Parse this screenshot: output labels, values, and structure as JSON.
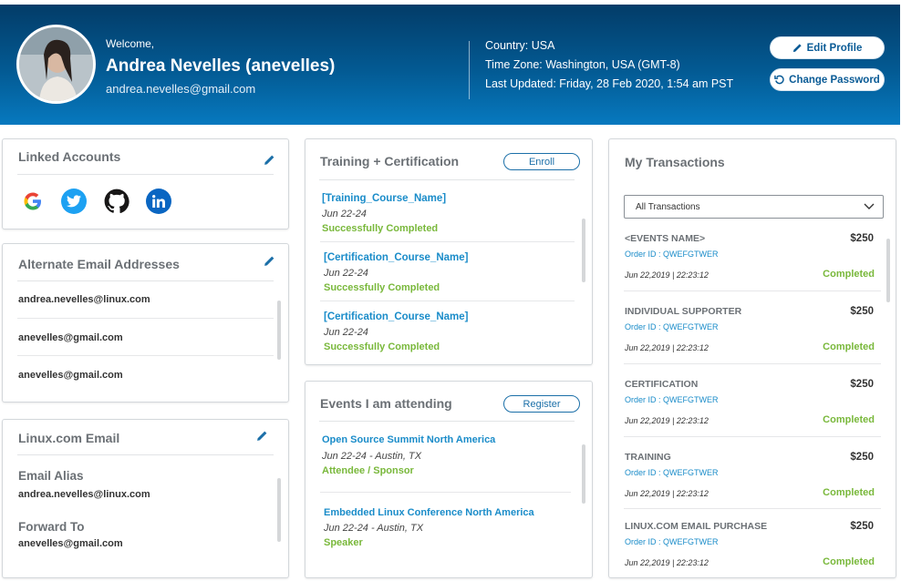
{
  "header": {
    "welcome": "Welcome,",
    "name": "Andrea Nevelles (anevelles)",
    "email": "andrea.nevelles@gmail.com",
    "country": "Country: USA",
    "timezone": "Time Zone: Washington, USA (GMT-8)",
    "last_updated": "Last Updated: Friday, 28 Feb 2020, 1:54 am PST",
    "edit_profile": "Edit Profile",
    "change_password": "Change Password"
  },
  "linked_accounts": {
    "title": "Linked Accounts",
    "accounts": [
      {
        "icon": "google-icon",
        "color": "#4285f4"
      },
      {
        "icon": "twitter-icon",
        "color": "#1da1f2"
      },
      {
        "icon": "github-icon",
        "color": "#181717"
      },
      {
        "icon": "linkedin-icon",
        "color": "#0a66c2"
      }
    ]
  },
  "alternate_emails": {
    "title": "Alternate Email Addresses",
    "emails": [
      "andrea.nevelles@linux.com",
      "anevelles@gmail.com",
      "anevelles@gmail.com"
    ]
  },
  "linux_email": {
    "title": "Linux.com Email",
    "alias_label": "Email Alias",
    "alias_value": "andrea.nevelles@linux.com",
    "forward_label": "Forward To",
    "forward_value": "anevelles@gmail.com"
  },
  "training": {
    "title": "Training + Certification",
    "button": "Enroll",
    "items": [
      {
        "name": "[Training_Course_Name]",
        "date": "Jun 22-24",
        "status": "Successfully Completed"
      },
      {
        "name": "[Certification_Course_Name]",
        "date": "Jun 22-24",
        "status": "Successfully Completed"
      },
      {
        "name": "[Certification_Course_Name]",
        "date": "Jun 22-24",
        "status": "Successfully Completed"
      }
    ]
  },
  "events": {
    "title": "Events I am attending",
    "button": "Register",
    "items": [
      {
        "name": "Open Source Summit North America",
        "date": "Jun 22-24 - Austin,  TX",
        "role": "Attendee / Sponsor"
      },
      {
        "name": "Embedded Linux Conference North America",
        "date": "Jun 22-24 - Austin,  TX",
        "role": "Speaker"
      }
    ]
  },
  "transactions": {
    "title": "My Transactions",
    "filter": "All Transactions",
    "items": [
      {
        "name": "<EVENTS NAME>",
        "amount": "$250",
        "order": "Order ID : QWEFGTWER",
        "date": "Jun 22,2019  |  22:23:12",
        "status": "Completed"
      },
      {
        "name": "INDIVIDUAL SUPPORTER",
        "amount": "$250",
        "order": "Order ID : QWEFGTWER",
        "date": "Jun 22,2019  |  22:23:12",
        "status": "Completed"
      },
      {
        "name": "CERTIFICATION",
        "amount": "$250",
        "order": "Order ID : QWEFGTWER",
        "date": "Jun 22,2019  |  22:23:12",
        "status": "Completed"
      },
      {
        "name": "TRAINING",
        "amount": "$250",
        "order": "Order ID : QWEFGTWER",
        "date": "Jun 22,2019  |  22:23:12",
        "status": "Completed"
      },
      {
        "name": "LINUX.COM EMAIL PURCHASE",
        "amount": "$250",
        "order": "Order ID : QWEFGTWER",
        "date": "Jun 22,2019  |  22:23:12",
        "status": "Completed"
      }
    ]
  },
  "colors": {
    "accent": "#1a8cc9",
    "success": "#79b83b",
    "header_dark": "#033c68"
  }
}
